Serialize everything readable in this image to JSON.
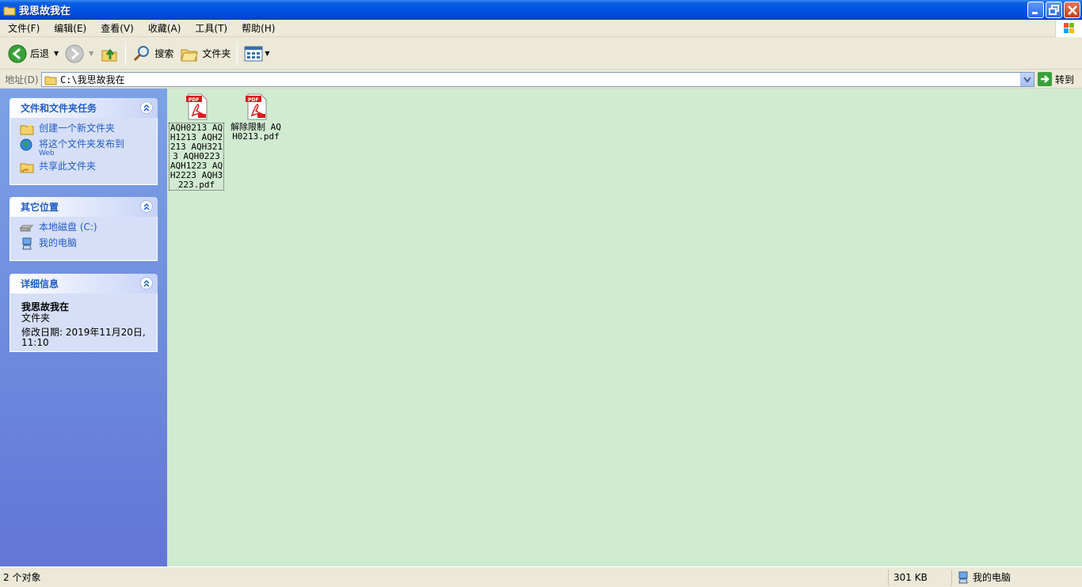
{
  "window": {
    "title": "我思故我在"
  },
  "menu": [
    {
      "label": "文件(F)"
    },
    {
      "label": "编辑(E)"
    },
    {
      "label": "查看(V)"
    },
    {
      "label": "收藏(A)"
    },
    {
      "label": "工具(T)"
    },
    {
      "label": "帮助(H)"
    }
  ],
  "toolbar": {
    "back_label": "后退",
    "search_label": "搜索",
    "folders_label": "文件夹"
  },
  "address": {
    "label": "地址(D)",
    "value": "C:\\我思故我在",
    "go_label": "转到"
  },
  "panels": {
    "tasks": {
      "title": "文件和文件夹任务",
      "items": [
        {
          "label": "创建一个新文件夹",
          "icon": "new-folder-icon"
        },
        {
          "label": "将这个文件夹发布到",
          "sub": "Web",
          "icon": "publish-web-icon"
        },
        {
          "label": "共享此文件夹",
          "icon": "share-folder-icon"
        }
      ]
    },
    "places": {
      "title": "其它位置",
      "items": [
        {
          "label": "本地磁盘 (C:)",
          "icon": "drive-icon"
        },
        {
          "label": "我的电脑",
          "icon": "my-computer-icon"
        }
      ]
    },
    "details": {
      "title": "详细信息",
      "name": "我思故我在",
      "type": "文件夹",
      "modified_line1": "修改日期: 2019年11月20日,",
      "modified_line2": "11:10"
    }
  },
  "files": [
    {
      "name": "AQH0213 AQH1213 AQH2213 AQH3213 AQH0223 AQH1223 AQH2223 AQH3223.pdf",
      "icon": "pdf-icon",
      "selected": true
    },
    {
      "name": "解除限制 AQH0213.pdf",
      "icon": "pdf-icon",
      "selected": false
    }
  ],
  "status": {
    "count": "2 个对象",
    "size": "301 KB",
    "location": "我的电脑"
  },
  "colors": {
    "title_bar": "#0054e3",
    "content_bg": "#d1ebd1",
    "task_link": "#215dc6"
  }
}
